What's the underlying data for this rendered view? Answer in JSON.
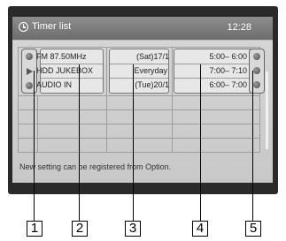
{
  "header": {
    "title": "Timer list",
    "time": "12:28",
    "icon": "clock-icon"
  },
  "rows": [
    {
      "left_icon": "record-dot-icon",
      "station": "FM 87.50MHz",
      "date": "(Sat)17/1",
      "time": "5:00– 6:00",
      "right_icon": "record-dot-icon"
    },
    {
      "left_icon": "play-icon",
      "station": "HDD JUKEBOX",
      "date": "Everyday",
      "time": "7:00– 7:10",
      "right_icon": "record-dot-icon"
    },
    {
      "left_icon": "record-dot-icon",
      "station": "AUDIO IN",
      "date": "(Tue)20/1",
      "time": "6:00– 7:00",
      "right_icon": "record-dot-icon"
    }
  ],
  "footer": {
    "message": "New setting can be registered from Option."
  },
  "callouts": [
    "1",
    "2",
    "3",
    "4",
    "5"
  ]
}
